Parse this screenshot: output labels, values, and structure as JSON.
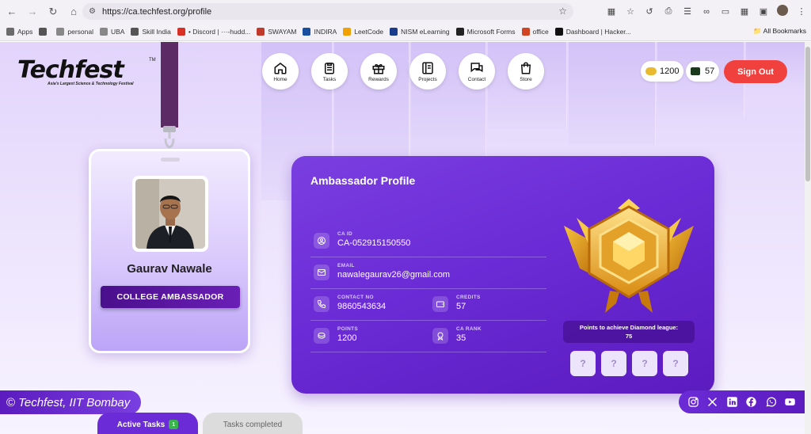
{
  "browser": {
    "url": "https://ca.techfest.org/profile",
    "bookmarks": [
      {
        "label": "Apps",
        "color": "#6b6b6b"
      },
      {
        "label": "",
        "color": "#555"
      },
      {
        "label": "personal",
        "color": "#888"
      },
      {
        "label": "UBA",
        "color": "#888"
      },
      {
        "label": "Skill India",
        "color": "#555"
      },
      {
        "label": "• Discord | ···-hudd...",
        "color": "#d93025"
      },
      {
        "label": "SWAYAM",
        "color": "#c0392b"
      },
      {
        "label": "INDIRA",
        "color": "#1a4fa0"
      },
      {
        "label": "LeetCode",
        "color": "#f0a000"
      },
      {
        "label": "NISM eLearning",
        "color": "#1a3c8c"
      },
      {
        "label": "Microsoft Forms",
        "color": "#222"
      },
      {
        "label": "office",
        "color": "#d14424"
      },
      {
        "label": "Dashboard | Hacker...",
        "color": "#111"
      }
    ],
    "all_bookmarks": "All Bookmarks"
  },
  "header": {
    "logo": "Techfest",
    "logo_tm": "TM",
    "tagline": "Asia's Largest Science & Technology Festival",
    "nav": [
      {
        "label": "Home",
        "icon": "home-icon"
      },
      {
        "label": "Tasks",
        "icon": "clipboard-icon"
      },
      {
        "label": "Rewards",
        "icon": "gift-icon"
      },
      {
        "label": "Projects",
        "icon": "book-icon"
      },
      {
        "label": "Contact",
        "icon": "chat-icon"
      },
      {
        "label": "Store",
        "icon": "bag-icon"
      }
    ],
    "coins": "1200",
    "credits": "57",
    "signout": "Sign Out"
  },
  "idcard": {
    "name": "Gaurav Nawale",
    "role": "COLLEGE AMBASSADOR"
  },
  "profile": {
    "title": "Ambassador Profile",
    "ca_id_label": "CA ID",
    "ca_id": "CA-052915150550",
    "email_label": "EMAIL",
    "email": "nawalegaurav26@gmail.com",
    "contact_label": "CONTACT NO",
    "contact": "9860543634",
    "credits_label": "CREDITS",
    "credits": "57",
    "points_label": "POINTS",
    "points": "1200",
    "rank_label": "CA RANK",
    "rank": "35",
    "diamond_text": "Points to achieve Diamond league:",
    "diamond_points": "75",
    "locked": [
      "?",
      "?",
      "?",
      "?"
    ]
  },
  "footer": {
    "copyright": "Techfest, IIT Bombay",
    "tab_active": "Active Tasks",
    "tab_active_count": "1",
    "tab_done": "Tasks completed"
  },
  "colors": {
    "accent": "#6b2bd6",
    "signout": "#f0413f",
    "badge_green": "#3ab44a"
  }
}
